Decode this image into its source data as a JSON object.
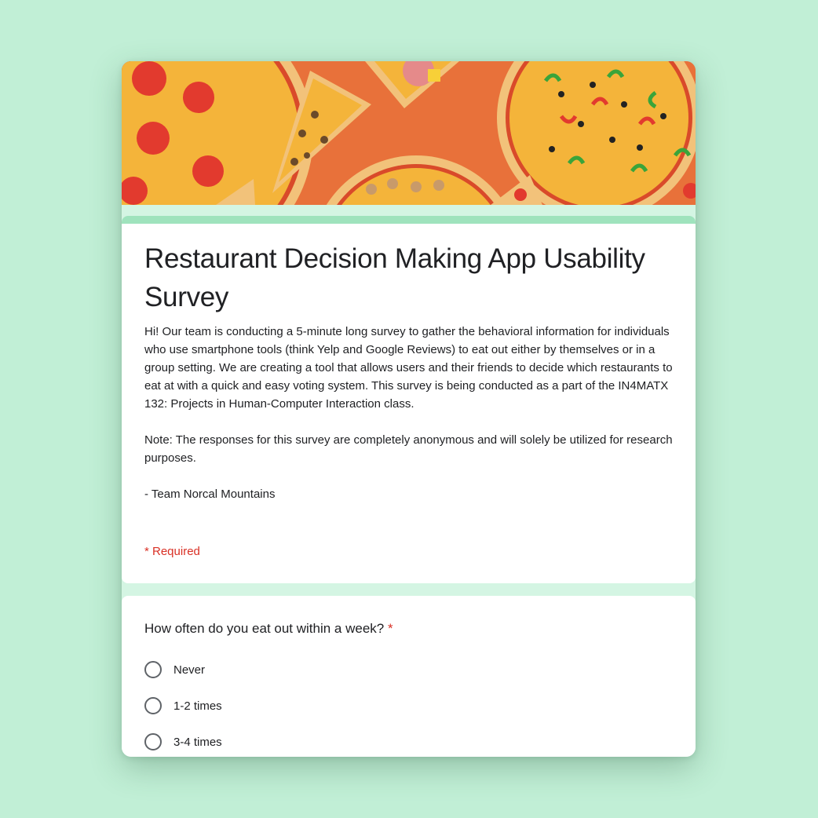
{
  "colors": {
    "page_background": "#c1efd6",
    "accent": "#9fe3bd",
    "required": "#d93025",
    "banner_background": "#e8713a"
  },
  "banner": {
    "image": "pizza-pattern-banner"
  },
  "form": {
    "title": "Restaurant Decision Making App Usability Survey",
    "description": [
      "Hi! Our team is conducting a 5-minute long survey to gather the behavioral information for individuals who use smartphone tools (think Yelp and Google Reviews) to eat out either by themselves or in a group setting. We are creating a tool that allows users and their friends to decide which restaurants to eat at with a quick and easy voting system. This survey is being conducted as a part of the IN4MATX 132: Projects in Human-Computer Interaction class.",
      "Note: The responses for this survey are completely anonymous and will solely be utilized for research purposes.",
      "- Team Norcal Mountains"
    ],
    "required_note": "* Required"
  },
  "question": {
    "text": "How often do you eat out within a week?",
    "required_marker": "*",
    "options": [
      {
        "label": "Never",
        "icon": "radio-unchecked-icon"
      },
      {
        "label": "1-2 times",
        "icon": "radio-unchecked-icon"
      },
      {
        "label": "3-4 times",
        "icon": "radio-unchecked-icon"
      }
    ]
  }
}
